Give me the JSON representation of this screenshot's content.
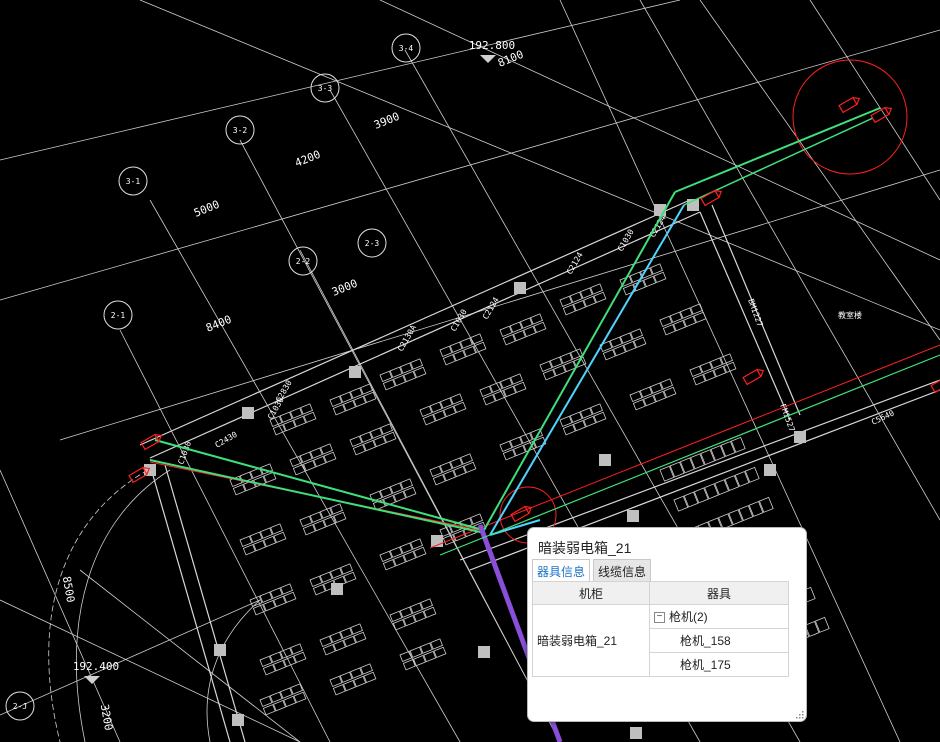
{
  "drawing": {
    "levels": [
      "192.800",
      "192.400"
    ],
    "axis_labels": [
      "3-1",
      "3-2",
      "3-3",
      "3-4",
      "2-1",
      "2-2",
      "2-3",
      "2-J"
    ],
    "dimensions": [
      "5000",
      "4200",
      "3900",
      "8100",
      "3000",
      "8400",
      "8500",
      "3200"
    ],
    "window_labels": [
      "C1030",
      "C2830",
      "C2430",
      "C2130A",
      "C1030",
      "C2124",
      "C2124",
      "C1030",
      "C2124",
      "C5640",
      "C1030"
    ],
    "door_labels": [
      "BM1227",
      "FM1527"
    ],
    "room_label": "教室楼",
    "colors": {
      "green": "#3ee07a",
      "cyan": "#4fd4ff",
      "red": "#ff2020",
      "purple": "#8a4fd8",
      "line": "#d8d8d8"
    }
  },
  "popup": {
    "title": "暗装弱电箱_21",
    "tabs": [
      "器具信息",
      "线缆信息"
    ],
    "active_tab": "器具信息",
    "columns": [
      "机柜",
      "器具"
    ],
    "cabinet": "暗装弱电箱_21",
    "group": {
      "label": "枪机(2)",
      "expanded": true,
      "children": [
        "枪机_158",
        "枪机_175"
      ]
    }
  }
}
